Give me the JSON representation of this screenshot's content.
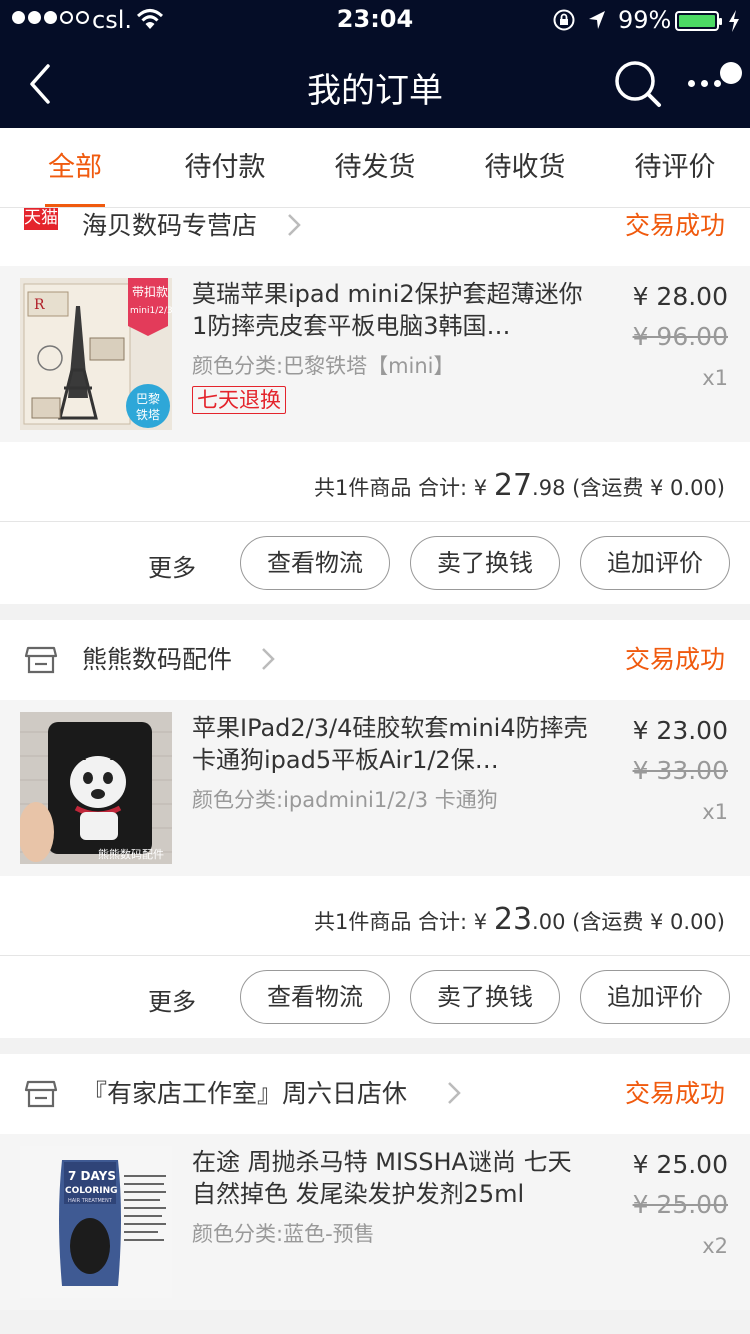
{
  "status_bar": {
    "carrier": "csl.",
    "time": "23:04",
    "battery": "99%",
    "battery_level": 0.99
  },
  "nav": {
    "title": "我的订单"
  },
  "tabs": [
    {
      "label": "全部",
      "active": true
    },
    {
      "label": "待付款",
      "active": false
    },
    {
      "label": "待发货",
      "active": false
    },
    {
      "label": "待收货",
      "active": false
    },
    {
      "label": "待评价",
      "active": false
    }
  ],
  "orders": [
    {
      "shop": {
        "name": "海贝数码专营店",
        "badge": "天猫"
      },
      "status": "交易成功",
      "item": {
        "title": "莫瑞苹果ipad mini2保护套超薄迷你1防摔壳皮套平板电脑3韩国…",
        "spec": "颜色分类:巴黎铁塔【mini】",
        "tag": "七天退换",
        "price": "¥ 28.00",
        "original_price": "¥ 96.00",
        "qty": "x1",
        "thumb_labels": {
          "corner": "带扣款",
          "corner2": "mini1/2/3",
          "circle1": "巴黎",
          "circle2": "铁塔"
        }
      },
      "summary": {
        "prefix": "共1件商品 合计: ¥",
        "total_int": "27",
        "total_dec": ".98",
        "shipping": "(含运费 ¥ 0.00)"
      },
      "actions": {
        "more": "更多",
        "btn1": "查看物流",
        "btn2": "卖了换钱",
        "btn3": "追加评价"
      }
    },
    {
      "shop": {
        "name": "熊熊数码配件"
      },
      "status": "交易成功",
      "item": {
        "title": "苹果IPad2/3/4硅胶软套mini4防摔壳卡通狗ipad5平板Air1/2保…",
        "spec": "颜色分类:ipadmini1/2/3 卡通狗",
        "price": "¥ 23.00",
        "original_price": "¥ 33.00",
        "qty": "x1",
        "thumb_labels": {
          "watermark": "熊熊数码配件"
        }
      },
      "summary": {
        "prefix": "共1件商品 合计: ¥",
        "total_int": "23",
        "total_dec": ".00",
        "shipping": "(含运费 ¥ 0.00)"
      },
      "actions": {
        "more": "更多",
        "btn1": "查看物流",
        "btn2": "卖了换钱",
        "btn3": "追加评价"
      }
    },
    {
      "shop": {
        "name": "『有家店工作室』周六日店休"
      },
      "status": "交易成功",
      "item": {
        "title": "在途 周抛杀马特 MISSHA谜尚 七天自然掉色 发尾染发护发剂25ml",
        "spec": "颜色分类:蓝色-预售",
        "price": "¥ 25.00",
        "original_price": "¥ 25.00",
        "qty": "x2",
        "thumb_labels": {
          "line1": "7 DAYS",
          "line2": "COLORING",
          "line3": "HAIR TREATMENT"
        }
      }
    }
  ],
  "colors": {
    "header_bg": "#050d27",
    "accent": "#f05a0e",
    "tmall_red": "#e4242c",
    "battery_green": "#4cd964"
  }
}
